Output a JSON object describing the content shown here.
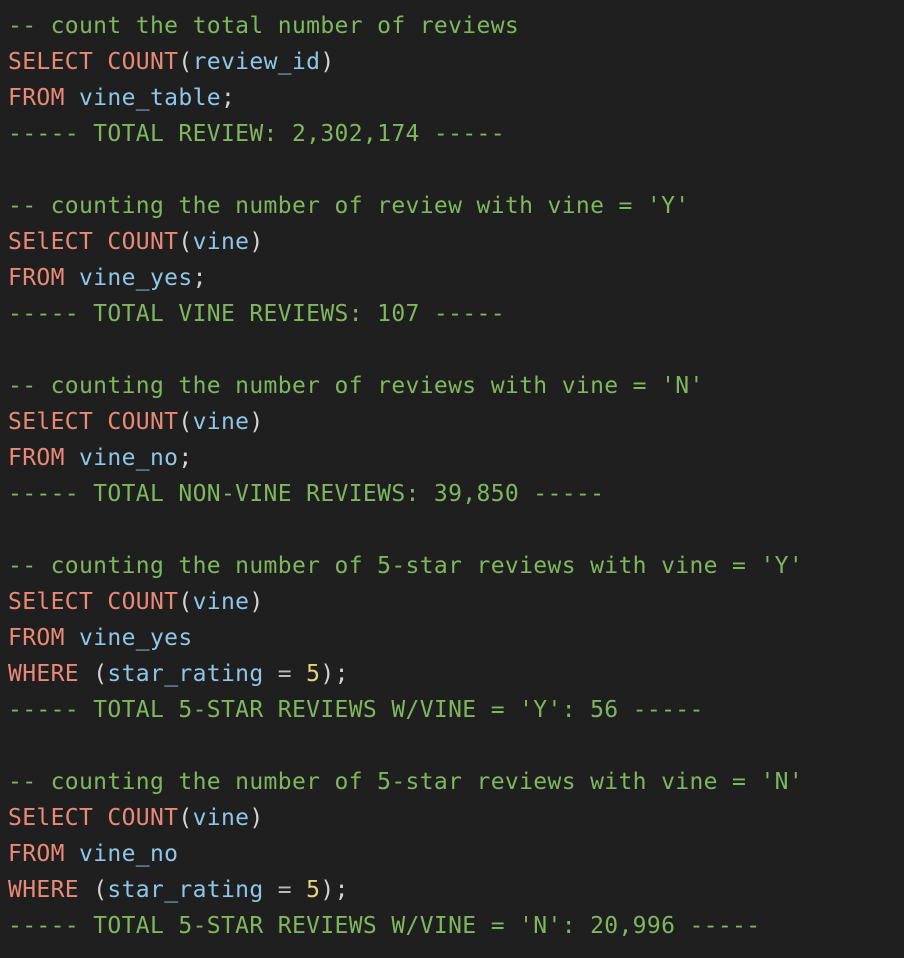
{
  "editor": {
    "lines": [
      {
        "tokens": [
          {
            "text": "-- count the total number of reviews",
            "type": "comment"
          }
        ]
      },
      {
        "tokens": [
          {
            "text": "SELECT",
            "type": "keyword"
          },
          {
            "text": " ",
            "type": "punct"
          },
          {
            "text": "COUNT",
            "type": "func"
          },
          {
            "text": "(",
            "type": "punct"
          },
          {
            "text": "review_id",
            "type": "ident"
          },
          {
            "text": ")",
            "type": "punct"
          }
        ]
      },
      {
        "tokens": [
          {
            "text": "FROM",
            "type": "keyword"
          },
          {
            "text": " ",
            "type": "punct"
          },
          {
            "text": "vine_table",
            "type": "ident"
          },
          {
            "text": ";",
            "type": "punct"
          }
        ]
      },
      {
        "tokens": [
          {
            "text": "----- TOTAL REVIEW: 2,302,174 -----",
            "type": "sep"
          }
        ]
      },
      {
        "tokens": []
      },
      {
        "tokens": [
          {
            "text": "-- counting the number of review with vine = 'Y'",
            "type": "comment"
          }
        ]
      },
      {
        "tokens": [
          {
            "text": "SElECT",
            "type": "keyword"
          },
          {
            "text": " ",
            "type": "punct"
          },
          {
            "text": "COUNT",
            "type": "func"
          },
          {
            "text": "(",
            "type": "punct"
          },
          {
            "text": "vine",
            "type": "ident"
          },
          {
            "text": ")",
            "type": "punct"
          }
        ]
      },
      {
        "tokens": [
          {
            "text": "FROM",
            "type": "keyword"
          },
          {
            "text": " ",
            "type": "punct"
          },
          {
            "text": "vine_yes",
            "type": "ident"
          },
          {
            "text": ";",
            "type": "punct"
          }
        ]
      },
      {
        "tokens": [
          {
            "text": "----- TOTAL VINE REVIEWS: 107 -----",
            "type": "sep"
          }
        ]
      },
      {
        "tokens": []
      },
      {
        "tokens": [
          {
            "text": "-- counting the number of reviews with vine = 'N'",
            "type": "comment"
          }
        ]
      },
      {
        "tokens": [
          {
            "text": "SElECT",
            "type": "keyword"
          },
          {
            "text": " ",
            "type": "punct"
          },
          {
            "text": "COUNT",
            "type": "func"
          },
          {
            "text": "(",
            "type": "punct"
          },
          {
            "text": "vine",
            "type": "ident"
          },
          {
            "text": ")",
            "type": "punct"
          }
        ]
      },
      {
        "tokens": [
          {
            "text": "FROM",
            "type": "keyword"
          },
          {
            "text": " ",
            "type": "punct"
          },
          {
            "text": "vine_no",
            "type": "ident"
          },
          {
            "text": ";",
            "type": "punct"
          }
        ]
      },
      {
        "tokens": [
          {
            "text": "----- TOTAL NON-VINE REVIEWS: 39,850 -----",
            "type": "sep"
          }
        ]
      },
      {
        "tokens": []
      },
      {
        "tokens": [
          {
            "text": "-- counting the number of 5-star reviews with vine = 'Y'",
            "type": "comment"
          }
        ]
      },
      {
        "tokens": [
          {
            "text": "SElECT",
            "type": "keyword"
          },
          {
            "text": " ",
            "type": "punct"
          },
          {
            "text": "COUNT",
            "type": "func"
          },
          {
            "text": "(",
            "type": "punct"
          },
          {
            "text": "vine",
            "type": "ident"
          },
          {
            "text": ")",
            "type": "punct"
          }
        ]
      },
      {
        "tokens": [
          {
            "text": "FROM",
            "type": "keyword"
          },
          {
            "text": " ",
            "type": "punct"
          },
          {
            "text": "vine_yes",
            "type": "ident"
          }
        ]
      },
      {
        "tokens": [
          {
            "text": "WHERE",
            "type": "keyword"
          },
          {
            "text": " (",
            "type": "punct"
          },
          {
            "text": "star_rating",
            "type": "ident"
          },
          {
            "text": " = ",
            "type": "op"
          },
          {
            "text": "5",
            "type": "number"
          },
          {
            "text": ");",
            "type": "punct"
          }
        ]
      },
      {
        "tokens": [
          {
            "text": "----- TOTAL 5-STAR REVIEWS W/VINE = 'Y': 56 -----",
            "type": "sep"
          }
        ]
      },
      {
        "tokens": []
      },
      {
        "tokens": [
          {
            "text": "-- counting the number of 5-star reviews with vine = 'N'",
            "type": "comment"
          }
        ]
      },
      {
        "tokens": [
          {
            "text": "SElECT",
            "type": "keyword"
          },
          {
            "text": " ",
            "type": "punct"
          },
          {
            "text": "COUNT",
            "type": "func"
          },
          {
            "text": "(",
            "type": "punct"
          },
          {
            "text": "vine",
            "type": "ident"
          },
          {
            "text": ")",
            "type": "punct"
          }
        ]
      },
      {
        "tokens": [
          {
            "text": "FROM",
            "type": "keyword"
          },
          {
            "text": " ",
            "type": "punct"
          },
          {
            "text": "vine_no",
            "type": "ident"
          }
        ]
      },
      {
        "tokens": [
          {
            "text": "WHERE",
            "type": "keyword"
          },
          {
            "text": " (",
            "type": "punct"
          },
          {
            "text": "star_rating",
            "type": "ident"
          },
          {
            "text": " = ",
            "type": "op"
          },
          {
            "text": "5",
            "type": "number"
          },
          {
            "text": ");",
            "type": "punct"
          }
        ]
      },
      {
        "tokens": [
          {
            "text": "----- TOTAL 5-STAR REVIEWS W/VINE = 'N': 20,996 -----",
            "type": "sep"
          }
        ]
      }
    ]
  },
  "theme": {
    "background": "#1f1f1f",
    "comment": "#7fb75f",
    "keyword": "#ea8a76",
    "identifier": "#8fc6e8",
    "number": "#e6d27a"
  }
}
